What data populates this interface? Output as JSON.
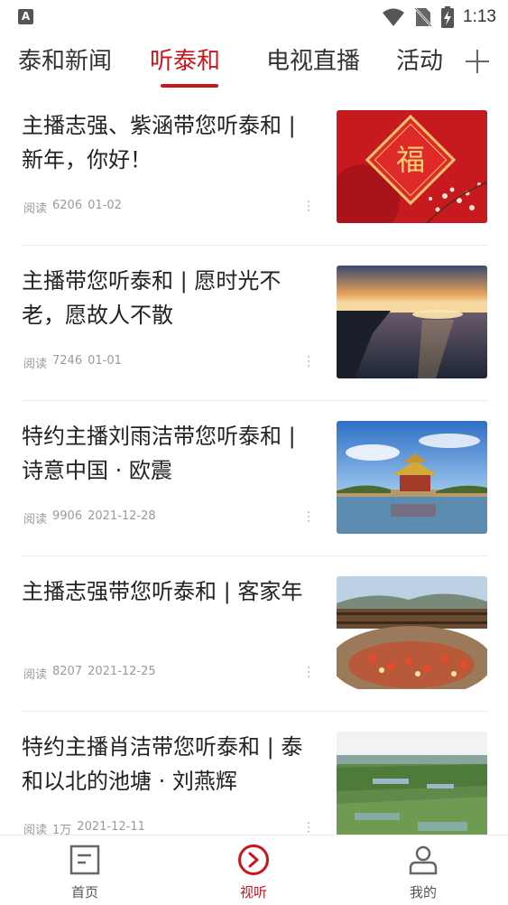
{
  "status_bar": {
    "notification_letter": "A",
    "time": "1:13",
    "icons": [
      "wifi-icon",
      "no-sim-icon",
      "battery-charging-icon"
    ]
  },
  "tabs": [
    {
      "label": "泰和新闻",
      "active": false
    },
    {
      "label": "听泰和",
      "active": true
    },
    {
      "label": "电视直播",
      "active": false
    },
    {
      "label": "活动",
      "active": false
    }
  ],
  "add_channel_icon": "plus-icon",
  "accent_color": "#c8161d",
  "articles": [
    {
      "title": "主播志强、紫涵带您听泰和 | 新年，你好！",
      "reads_label": "阅读",
      "reads": "6206",
      "date": "01-02",
      "image": "red-fu-character-new-year"
    },
    {
      "title": "主播带您听泰和 | 愿时光不老，愿故人不散",
      "reads_label": "阅读",
      "reads": "7246",
      "date": "01-01",
      "image": "sunset-over-sea"
    },
    {
      "title": "特约主播刘雨洁带您听泰和 | 诗意中国 · 欧震",
      "reads_label": "阅读",
      "reads": "9906",
      "date": "2021-12-28",
      "image": "palace-tower-by-moat"
    },
    {
      "title": "主播志强带您听泰和 | 客家年",
      "reads_label": "阅读",
      "reads": "8207",
      "date": "2021-12-25",
      "image": "hakka-tulou-courtyard"
    },
    {
      "title": "特约主播肖洁带您听泰和 | 泰和以北的池塘 · 刘燕辉",
      "reads_label": "阅读",
      "reads": "1万",
      "date": "2021-12-11",
      "image": "countryside-ponds-aerial"
    }
  ],
  "bottom_nav": [
    {
      "label": "首页",
      "icon": "document-icon",
      "active": false
    },
    {
      "label": "视听",
      "icon": "play-circle-icon",
      "active": true
    },
    {
      "label": "我的",
      "icon": "user-icon",
      "active": false
    }
  ]
}
